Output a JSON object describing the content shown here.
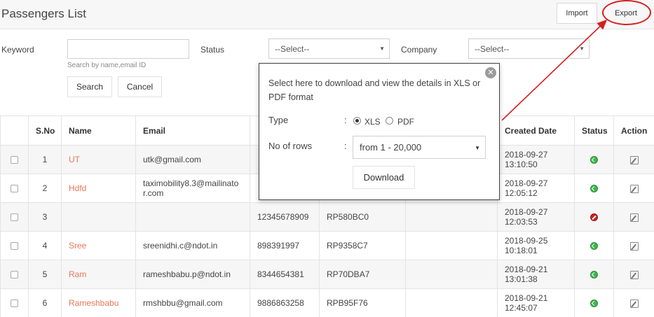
{
  "header": {
    "title": "Passengers List",
    "import_label": "Import",
    "export_label": "Export"
  },
  "filters": {
    "keyword_label": "Keyword",
    "keyword_value": "",
    "keyword_hint": "Search by name,email ID",
    "status_label": "Status",
    "status_value": "--Select--",
    "company_label": "Company",
    "company_value": "--Select--",
    "search_label": "Search",
    "cancel_label": "Cancel"
  },
  "table": {
    "headers": [
      "",
      "S.No",
      "Name",
      "Email",
      "",
      "",
      "",
      "Created Date",
      "Status",
      "Action"
    ],
    "rows": [
      {
        "sno": "1",
        "name": "UT",
        "email": "utk@gmail.com",
        "phone": "",
        "ref": "",
        "extra": "",
        "created": "2018-09-27 13:10:50",
        "status": "active"
      },
      {
        "sno": "2",
        "name": "Hdfd",
        "email": "taximobility8.3@mailinator.com",
        "phone": "",
        "ref": "",
        "extra": "",
        "created": "2018-09-27 12:05:12",
        "status": "active"
      },
      {
        "sno": "3",
        "name": "",
        "email": "",
        "phone": "12345678909",
        "ref": "RP580BC0",
        "extra": "",
        "created": "2018-09-27 12:03:53",
        "status": "blocked"
      },
      {
        "sno": "4",
        "name": "Sree",
        "email": "sreenidhi.c@ndot.in",
        "phone": "898391997",
        "ref": "RP9358C7",
        "extra": "",
        "created": "2018-09-25 10:18:01",
        "status": "active"
      },
      {
        "sno": "5",
        "name": "Ram",
        "email": "rameshbabu.p@ndot.in",
        "phone": "8344654381",
        "ref": "RP70DBA7",
        "extra": "",
        "created": "2018-09-21 13:01:38",
        "status": "active"
      },
      {
        "sno": "6",
        "name": "Rameshbabu",
        "email": "rmshbbu@gmail.com",
        "phone": "9886863258",
        "ref": "RPB95F76",
        "extra": "",
        "created": "2018-09-21 12:45:07",
        "status": "active"
      }
    ]
  },
  "export_modal": {
    "description": "Select here to download and view the details in XLS or PDF format",
    "type_label": "Type",
    "colon": ":",
    "option_xls": "XLS",
    "option_pdf": "PDF",
    "selected_type": "XLS",
    "rows_label": "No of rows",
    "rows_value": "from 1 - 20,000",
    "download_label": "Download",
    "close_glyph": "✕"
  },
  "colors": {
    "accent_name": "#e8775a",
    "annotation": "#d42020",
    "status_active": "#3cb54a",
    "status_blocked": "#cc1f1f"
  },
  "icons": {
    "close": "close-icon",
    "edit": "edit-icon",
    "status_active": "status-active-icon",
    "status_blocked": "status-blocked-icon",
    "checkbox": "checkbox"
  }
}
